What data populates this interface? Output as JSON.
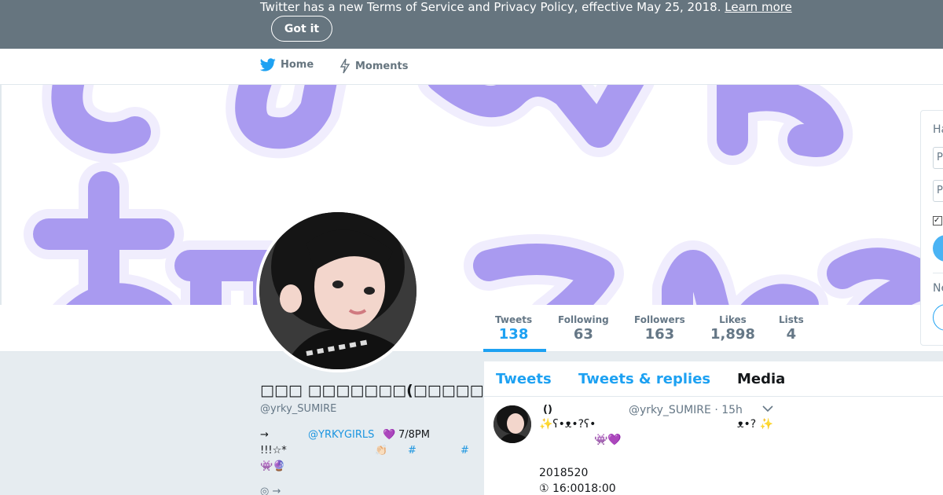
{
  "banner": {
    "text": "Twitter has a new Terms of Service and Privacy Policy, effective May 25, 2018.",
    "link": "Learn more",
    "button": "Got it"
  },
  "nav": {
    "home": "Home",
    "moments": "Moments"
  },
  "stats": [
    {
      "label": "Tweets",
      "value": "138"
    },
    {
      "label": "Following",
      "value": "63"
    },
    {
      "label": "Followers",
      "value": "163"
    },
    {
      "label": "Likes",
      "value": "1,898"
    },
    {
      "label": "Lists",
      "value": "4"
    }
  ],
  "profile": {
    "name": "□□□ □□□□□□□(□□□□□□□□□□□□)",
    "handle": "@yrky_SUMIRE",
    "bio": {
      "line1_arrow": "→",
      "line1_link": "@YRKYGIRLS",
      "line1_emoji": "💜",
      "line1_tail": "7/8PM",
      "line2_text": "!!!☆*",
      "line2_emoji": "👏🏻",
      "line2_hash1": "#",
      "line2_hash2": "#",
      "line3_emoji": "👾🔮",
      "line4": "◎ →"
    }
  },
  "tabs": {
    "tweets": "Tweets",
    "replies": "Tweets & replies",
    "media": "Media"
  },
  "tweet": {
    "name": "()",
    "handle": "@yrky_SUMIRE",
    "time": "· 15h",
    "line1_start": "✨ʕ•ᴥ•?ʕ•",
    "line1_end": "ᴥ•? ✨",
    "line2": "👾💜",
    "date": "2018520",
    "time_line": "① 16:0018:00"
  },
  "login": {
    "title": "Ha",
    "field1": "P",
    "field2": "P",
    "check": "✓",
    "new_label": "Ne"
  },
  "colors": {
    "banner_bg": "#66757f",
    "accent": "#1da1f2",
    "header_letters": "#a99af0"
  }
}
